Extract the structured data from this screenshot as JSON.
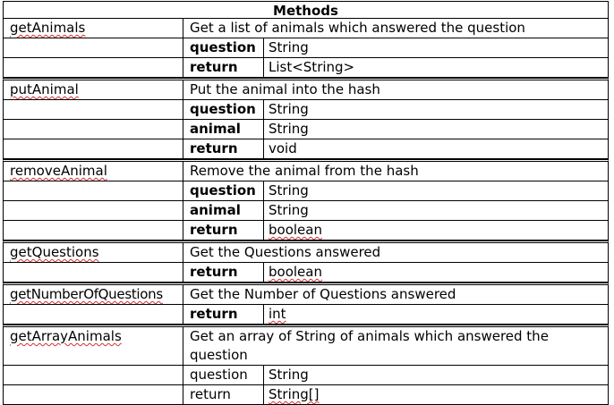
{
  "table": {
    "header": "Methods",
    "methods": [
      {
        "name": "getAnimals",
        "description": "Get a list of animals which answered the question",
        "params": [
          {
            "key": "question",
            "value": "String"
          },
          {
            "key": "return",
            "value": "List<String>"
          }
        ]
      },
      {
        "name": "putAnimal",
        "description": "Put the animal into the hash",
        "params": [
          {
            "key": "question",
            "value": "String"
          },
          {
            "key": "animal",
            "value": "String"
          },
          {
            "key": "return",
            "value": "void"
          }
        ]
      },
      {
        "name": "removeAnimal",
        "description": "Remove the animal from the hash",
        "params": [
          {
            "key": "question",
            "value": "String"
          },
          {
            "key": "animal",
            "value": "String"
          },
          {
            "key": "return",
            "value": "boolean"
          }
        ]
      },
      {
        "name": "getQuestions",
        "description": "Get the Questions answered",
        "params": [
          {
            "key": "return",
            "value": "boolean"
          }
        ]
      },
      {
        "name": "getNumberOfQuestions",
        "description": "Get the Number of Questions answered",
        "params": [
          {
            "key": "return",
            "value": "int"
          }
        ]
      },
      {
        "name": "getArrayAnimals",
        "description": "Get an array of String of animals which answered the question",
        "params": [
          {
            "key": "question",
            "value": "String"
          },
          {
            "key": "return",
            "value": "String[]"
          }
        ]
      }
    ]
  }
}
